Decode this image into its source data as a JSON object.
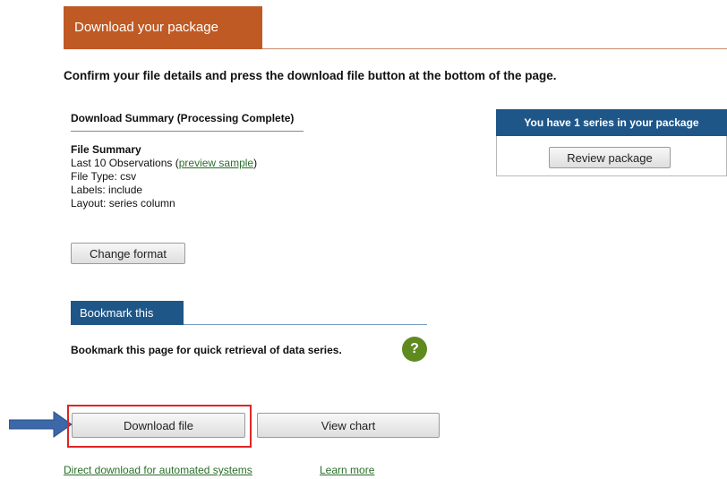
{
  "header": {
    "tab_label": "Download your package"
  },
  "intro": "Confirm your file details and press the download file button at the bottom of the page.",
  "summary": {
    "title": "Download Summary (Processing Complete)",
    "file_summary_label": "File Summary",
    "observations_prefix": "Last 10 Observations (",
    "preview_link": "preview sample",
    "observations_suffix": ")",
    "file_type": "File Type: csv",
    "labels": "Labels: include",
    "layout": "Layout: series column",
    "change_format_label": "Change format"
  },
  "bookmark": {
    "tab_label": "Bookmark this",
    "text": "Bookmark this page for quick retrieval of data series.",
    "help_glyph": "?"
  },
  "actions": {
    "download_label": "Download file",
    "view_chart_label": "View chart",
    "direct_download_link": "Direct download for automated systems",
    "learn_more_link": "Learn more"
  },
  "package": {
    "header": "You have 1 series in your package",
    "review_label": "Review package"
  },
  "colors": {
    "header_orange": "#bf5a24",
    "header_blue": "#1f5688",
    "link_green": "#2a6e2a",
    "help_green": "#5f8a20",
    "highlight_red": "#e02424",
    "arrow_blue": "#3c67a8"
  },
  "icons": {
    "help": "help-icon",
    "pointer_arrow": "arrow-right-icon"
  }
}
